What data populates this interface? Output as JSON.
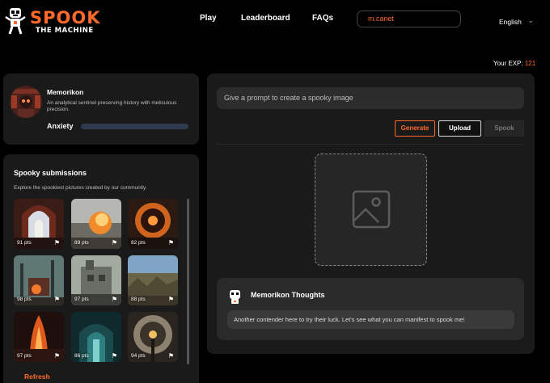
{
  "header": {
    "logo_title": "SPOOK",
    "logo_subtitle": "THE MACHINE",
    "nav": [
      "Play",
      "Leaderboard",
      "FAQs"
    ],
    "username": "m.canet",
    "language": "English"
  },
  "exp": {
    "label": "Your EXP:",
    "value": "121"
  },
  "character": {
    "name": "Memorikon",
    "description": "An analytical sentinel preserving history with meticulous precision.",
    "mood_label": "Anxiety"
  },
  "submissions": {
    "title": "Spooky submissions",
    "description": "Explore the spookiest pictures created by our community.",
    "items": [
      {
        "points": "91 pts"
      },
      {
        "points": "89 pts"
      },
      {
        "points": "82 pts"
      },
      {
        "points": "98 pts"
      },
      {
        "points": "97 pts"
      },
      {
        "points": "88 pts"
      },
      {
        "points": "97 pts"
      },
      {
        "points": "86 pts"
      },
      {
        "points": "94 pts"
      }
    ],
    "refresh_label": "Refresh"
  },
  "creator": {
    "prompt_placeholder": "Give a prompt to create a spooky image",
    "buttons": {
      "generate": "Generate",
      "upload": "Upload",
      "spook": "Spook"
    }
  },
  "thoughts": {
    "title": "Memorikon Thoughts",
    "message": "Another contender here to try their luck. Let's see what you can manifest to spook me!"
  },
  "colors": {
    "accent": "#ff6a2b",
    "panel": "#1a1a1a",
    "background": "#000000"
  }
}
